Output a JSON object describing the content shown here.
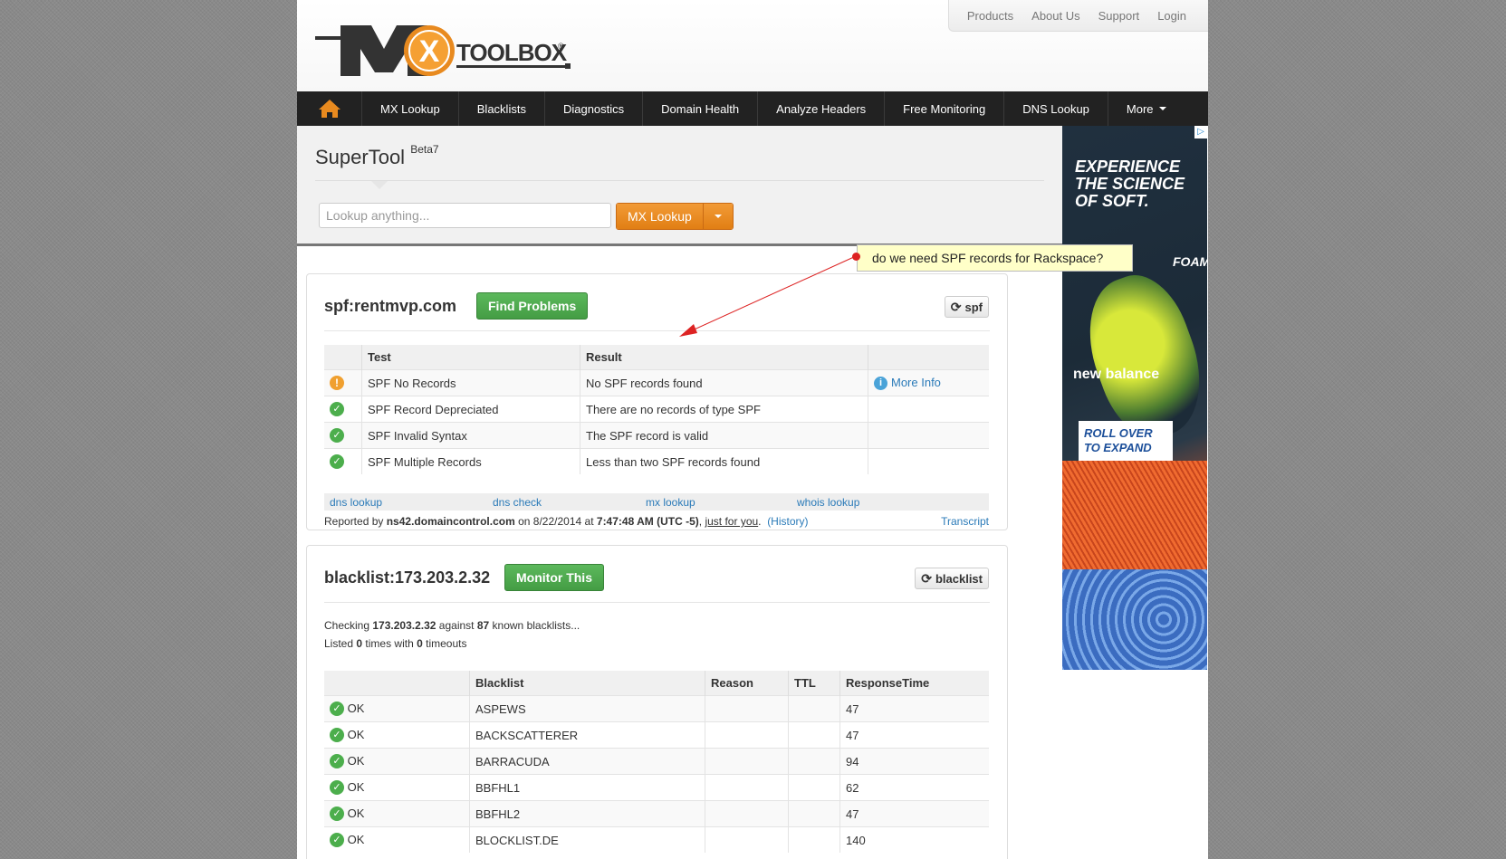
{
  "toplinks": [
    "Products",
    "About Us",
    "Support",
    "Login"
  ],
  "logo": {
    "wordmark": "TOOLBOX"
  },
  "nav": {
    "items": [
      "MX Lookup",
      "Blacklists",
      "Diagnostics",
      "Domain Health",
      "Analyze Headers",
      "Free Monitoring",
      "DNS Lookup",
      "More"
    ]
  },
  "supertool": {
    "title": "SuperTool",
    "beta": "Beta7",
    "search_placeholder": "Lookup anything...",
    "button": "MX Lookup"
  },
  "callout": {
    "text": "do we need SPF records for Rackspace?"
  },
  "spf": {
    "title": "spf:rentmvp.com",
    "action": "Find Problems",
    "refresh": "spf",
    "headers": [
      "Test",
      "Result"
    ],
    "rows": [
      {
        "status": "warning",
        "test": "SPF No Records",
        "result": "No SPF records found",
        "more": "More Info"
      },
      {
        "status": "ok",
        "test": "SPF Record Depreciated",
        "result": "There are no records of type SPF",
        "more": ""
      },
      {
        "status": "ok",
        "test": "SPF Invalid Syntax",
        "result": "The SPF record is valid",
        "more": ""
      },
      {
        "status": "ok",
        "test": "SPF Multiple Records",
        "result": "Less than two SPF records found",
        "more": ""
      }
    ],
    "links": [
      "dns lookup",
      "dns check",
      "mx lookup",
      "whois lookup"
    ],
    "reported": {
      "by_label": "Reported by",
      "server": "ns42.domaincontrol.com",
      "on_label": "on",
      "date": "8/22/2014",
      "at_label": "at",
      "time": "7:47:48 AM (UTC -5)",
      "just": "just for you",
      "history": "(History)",
      "transcript": "Transcript"
    }
  },
  "blacklist": {
    "title": "blacklist:173.203.2.32",
    "action": "Monitor This",
    "refresh": "blacklist",
    "checking": {
      "prefix": "Checking",
      "ip": "173.203.2.32",
      "against": "against",
      "count": "87",
      "suffix": "known blacklists..."
    },
    "listed": {
      "prefix": "Listed",
      "times": "0",
      "mid": "times with",
      "timeouts": "0",
      "suffix": "timeouts"
    },
    "headers": [
      "Blacklist",
      "Reason",
      "TTL",
      "ResponseTime"
    ],
    "rows": [
      {
        "status": "OK",
        "name": "ASPEWS",
        "reason": "",
        "ttl": "",
        "time": "47"
      },
      {
        "status": "OK",
        "name": "BACKSCATTERER",
        "reason": "",
        "ttl": "",
        "time": "47"
      },
      {
        "status": "OK",
        "name": "BARRACUDA",
        "reason": "",
        "ttl": "",
        "time": "94"
      },
      {
        "status": "OK",
        "name": "BBFHL1",
        "reason": "",
        "ttl": "",
        "time": "62"
      },
      {
        "status": "OK",
        "name": "BBFHL2",
        "reason": "",
        "ttl": "",
        "time": "47"
      },
      {
        "status": "OK",
        "name": "BLOCKLIST.DE",
        "reason": "",
        "ttl": "",
        "time": "140"
      }
    ]
  },
  "ad": {
    "headline": [
      "EXPERIENCE",
      "THE SCIENCE",
      "OF SOFT."
    ],
    "foam": "FOAM.",
    "brand": "new balance",
    "cta": [
      "ROLL OVER",
      "TO EXPAND"
    ]
  },
  "colors": {
    "nav_bg": "#222222",
    "orange": "#e88a1f",
    "green": "#4cae4c",
    "link": "#2a7ab8",
    "callout_bg": "#ffffc8"
  }
}
